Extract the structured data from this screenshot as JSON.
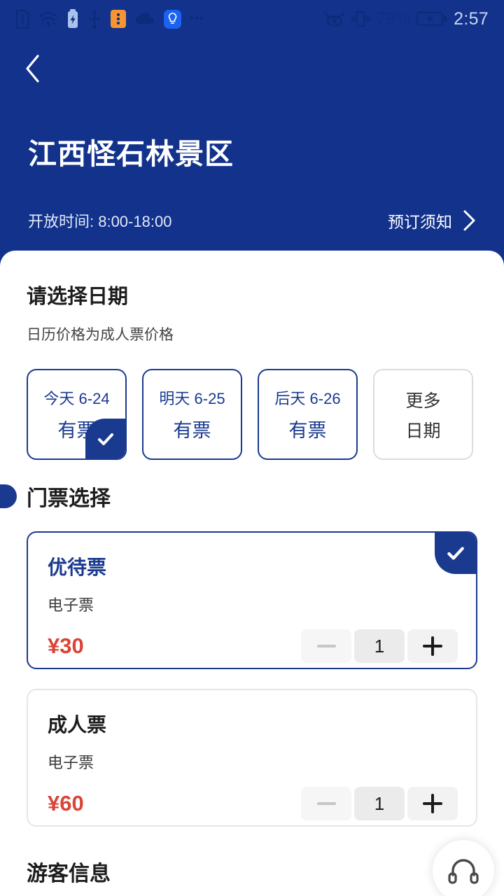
{
  "statusbar": {
    "icons": [
      "sim-alert-icon",
      "wifi-icon",
      "battery-charging-icon",
      "usb-icon",
      "app-badge-icon",
      "cloud-icon",
      "lightbulb-icon",
      "more-dots-icon"
    ],
    "right_icons": [
      "eye-care-icon",
      "vibrate-icon",
      "battery-charging-icon"
    ],
    "battery_percent": "79%",
    "time": "2:57"
  },
  "header": {
    "back_icon": "chevron-left-icon",
    "title": "江西怪石林景区",
    "open_time": "开放时间: 8:00-18:00",
    "notice_label": "预订须知",
    "notice_icon": "chevron-right-icon",
    "bg_color": "#12328c"
  },
  "date_section": {
    "title": "请选择日期",
    "subtitle": "日历价格为成人票价格",
    "cards": [
      {
        "top": "今天 6-24",
        "bottom": "有票",
        "selected": true
      },
      {
        "top": "明天 6-25",
        "bottom": "有票",
        "selected": false
      },
      {
        "top": "后天 6-26",
        "bottom": "有票",
        "selected": false
      },
      {
        "top": "更多",
        "bottom": "日期",
        "selected": false
      }
    ],
    "check_icon": "check-icon"
  },
  "ticket_section": {
    "title": "门票选择",
    "tickets": [
      {
        "name": "优待票",
        "type": "电子票",
        "price": "¥30",
        "quantity": "1",
        "selected": true,
        "minus_label": "minus-icon",
        "plus_label": "plus-icon"
      },
      {
        "name": "成人票",
        "type": "电子票",
        "price": "¥60",
        "quantity": "1",
        "selected": false,
        "minus_label": "minus-icon",
        "plus_label": "plus-icon"
      }
    ],
    "check_icon": "check-icon",
    "accent_color": "#1a3a8f",
    "price_color": "#d94436"
  },
  "visitor_section": {
    "title": "游客信息"
  },
  "fab": {
    "icon": "headset-icon"
  }
}
